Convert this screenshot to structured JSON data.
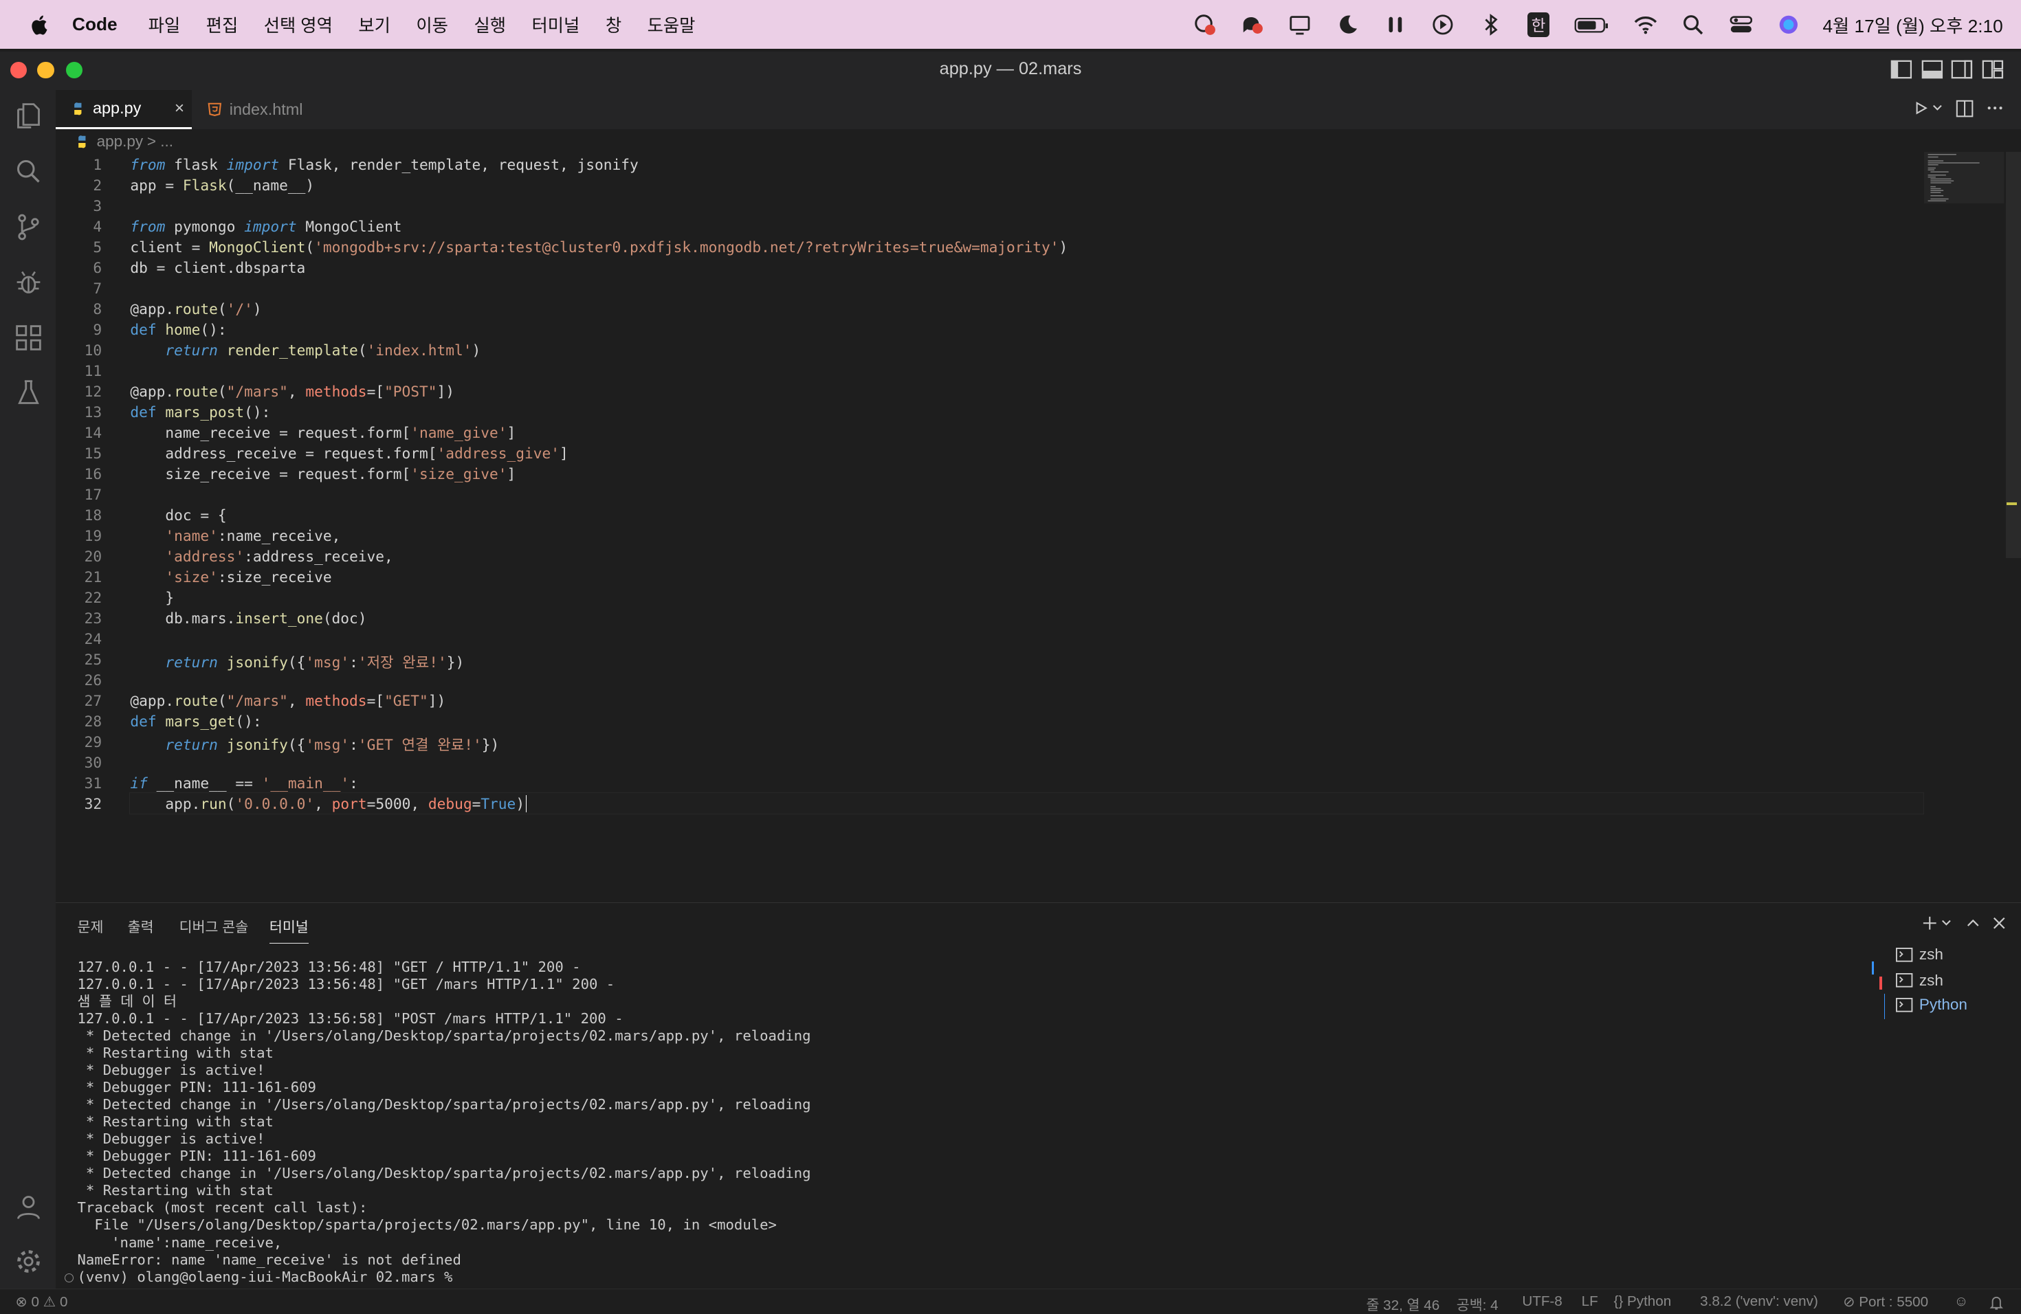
{
  "menubar": {
    "app_name": "Code",
    "menus": [
      "파일",
      "편집",
      "선택 영역",
      "보기",
      "이동",
      "실행",
      "터미널",
      "창",
      "도움말"
    ],
    "input_indicator": "한",
    "clock": "4월 17일 (월) 오후 2:10"
  },
  "window": {
    "title": "app.py — 02.mars"
  },
  "tabs": [
    {
      "label": "app.py",
      "close": "×"
    },
    {
      "label": "index.html"
    }
  ],
  "breadcrumb": {
    "file": "app.py",
    "rest": "> ..."
  },
  "editor": {
    "line_numbers": [
      "1",
      "2",
      "3",
      "4",
      "5",
      "6",
      "7",
      "8",
      "9",
      "10",
      "11",
      "12",
      "13",
      "14",
      "15",
      "16",
      "17",
      "18",
      "19",
      "20",
      "21",
      "22",
      "23",
      "24",
      "25",
      "26",
      "27",
      "28",
      "29",
      "30",
      "31",
      "32"
    ],
    "lines": [
      "from flask import Flask, render_template, request, jsonify",
      "app = Flask(__name__)",
      "",
      "from pymongo import MongoClient",
      "client = MongoClient('mongodb+srv://sparta:test@cluster0.pxdfjsk.mongodb.net/?retryWrites=true&w=majority')",
      "db = client.dbsparta",
      "",
      "@app.route('/')",
      "def home():",
      "    return render_template('index.html')",
      "",
      "@app.route(\"/mars\", methods=[\"POST\"])",
      "def mars_post():",
      "    name_receive = request.form['name_give']",
      "    address_receive = request.form['address_give']",
      "    size_receive = request.form['size_give']",
      "",
      "    doc = {",
      "    'name':name_receive,",
      "    'address':address_receive,",
      "    'size':size_receive",
      "    }",
      "    db.mars.insert_one(doc)",
      "",
      "    return jsonify({'msg':'저장 완료!'})",
      "",
      "@app.route(\"/mars\", methods=[\"GET\"])",
      "def mars_get():",
      "    return jsonify({'msg':'GET 연결 완료!'})",
      "",
      "if __name__ == '__main__':",
      "    app.run('0.0.0.0', port=5000, debug=True)"
    ]
  },
  "panel": {
    "tabs": [
      "문제",
      "출력",
      "디버그 콘솔",
      "터미널"
    ],
    "terminal_output": [
      "127.0.0.1 - - [17/Apr/2023 13:56:48] \"GET / HTTP/1.1\" 200 -",
      "127.0.0.1 - - [17/Apr/2023 13:56:48] \"GET /mars HTTP/1.1\" 200 -",
      "샘 플 데 이 터",
      "127.0.0.1 - - [17/Apr/2023 13:56:58] \"POST /mars HTTP/1.1\" 200 -",
      " * Detected change in '/Users/olang/Desktop/sparta/projects/02.mars/app.py', reloading",
      " * Restarting with stat",
      " * Debugger is active!",
      " * Debugger PIN: 111-161-609",
      " * Detected change in '/Users/olang/Desktop/sparta/projects/02.mars/app.py', reloading",
      " * Restarting with stat",
      " * Debugger is active!",
      " * Debugger PIN: 111-161-609",
      " * Detected change in '/Users/olang/Desktop/sparta/projects/02.mars/app.py', reloading",
      " * Restarting with stat",
      "Traceback (most recent call last):",
      "  File \"/Users/olang/Desktop/sparta/projects/02.mars/app.py\", line 10, in <module>",
      "    'name':name_receive,",
      "NameError: name 'name_receive' is not defined",
      "(venv) olang@olaeng-iui-MacBookAir 02.mars % "
    ],
    "terminal_list": [
      "zsh",
      "zsh",
      "Python"
    ]
  },
  "statusbar": {
    "errors": "0",
    "warnings": "0",
    "position": "줄 32, 열 46",
    "spaces": "공백: 4",
    "encoding": "UTF-8",
    "eol": "LF",
    "language": "Python",
    "interpreter": "3.8.2 ('venv': venv)",
    "port": "Port : 5500"
  }
}
